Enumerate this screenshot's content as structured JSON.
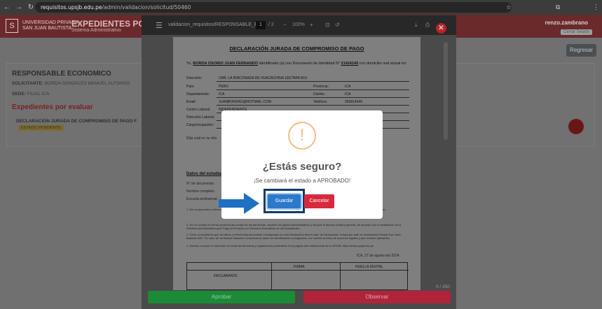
{
  "browser": {
    "url_host": "requisitos.upsjb.edu.pe",
    "url_path": "/admin/validacion/solicitud/50460"
  },
  "app": {
    "logo_line1": "UNIVERSIDAD PRIVADA",
    "logo_line2": "SAN JUAN BAUTISTA",
    "title": "EXPEDIENTES POR EV",
    "subtitle": "Sistema Administrativo",
    "user": "renzo.zambrano",
    "logout": "Cerrar Sesión",
    "back_button": "Regresar"
  },
  "card": {
    "title": "RESPONSABLE ECONOMICO",
    "solicitante_label": "SOLICITANTE:",
    "solicitante_value": "BORDA GONZALES MANUEL ALFONSO",
    "sede_label": "SEDE:",
    "sede_value": "FILIAL ICA",
    "section_title": "Expedientes por evaluar",
    "item_title": "DECLARACIÓN JURADA DE COMPROMISO DE PAGO F",
    "item_badge": "ESTADO: PENDIENTE"
  },
  "viewer": {
    "filename": "validacion_requisitos/RESPONSABLE_E...",
    "page_current": "1",
    "page_total": "/ 2",
    "zoom": "100%",
    "counter": "0 / 250",
    "approve_button": "Aprobar",
    "observe_button": "Observar"
  },
  "pdf": {
    "heading": "DECLARACIÓN JURADA DE COMPROMISO DE PAGO",
    "intro_pre": "Yo, ",
    "intro_name": "BORDA OSORIO JUAN FERNANDO",
    "intro_mid": " identificado (a) con Documento de Identidad N° ",
    "intro_dni": "21424140",
    "intro_post": " con domicilio real actual en:",
    "fields": {
      "direccion_label": "Dirección:",
      "direccion_value": "URB. LA RINCONADA DE HUACACHINA 1EETAPA B19",
      "pais_label": "País:",
      "pais_value": "PERÚ",
      "provincia_label": "Provincia:",
      "provincia_value": "ICA",
      "departamento_label": "Departamento:",
      "departamento_value": "ICA",
      "distrito_label": "Distrito:",
      "distrito_value": "ICA",
      "email_label": "Email:",
      "email_value": "JUANBORDAO@HOTMAIL.COM",
      "telefono_label": "Teléfono:",
      "telefono_value": "955814949",
      "centro_label": "Centro Laboral:",
      "centro_value": "INDEPENDIENTE",
      "direccion_laboral_label": "Dirección Laboral:",
      "cargo_label": "Cargo/ocupación:"
    },
    "elija": "Elija cuál es su rela",
    "section_estudiante": "Datos del estudia",
    "doc_label": "N° de documento:",
    "nombre_label": "Nombre completo:",
    "escuela_label": "Escuela profesional",
    "para1": "1. Me comprometo a efectuar los pagos... generados, desde la fecha... de los Estudiantes vigente... académicos con procedimientos declare conocer y respetar.",
    "para2": "2. De no cumplir en forma oportuna las cuotas de las pensiones, asumiré los gastos administrativos y los que el alumno pudiera generar, de acuerdo con lo establecido en la Directiva Administrativa para Pago de Pensión por Servicios Educativos de los Estudiantes.",
    "para3": "3. Tomo conocimiento que los datos y referencias personales consignadas en esta declaración tienen valor de Declaración Jurada por ante la Universidad Privada San Juan Bautista SAC. En caso de verificarse falsedad o ausencia de datos de identificación consignados, me someto al inicio de acciones legales y que resulten aplicables.",
    "para4": "4. Declaro conocer el contenido de todas las directivas y reglamentos publicados en la página web institucional de la UPSJB: https://www.upsjb.edu.pe",
    "date": "ICA, 27 de agosto del 2024",
    "col_firma": "FIRMA",
    "col_huella": "HUELLA DIGITAL",
    "col_declarante": "DECLARANTE"
  },
  "dialog": {
    "icon": "!",
    "title": "¿Estás seguro?",
    "text": "¡Se cambiará el estado a APROBADO!",
    "confirm": "Guardar",
    "cancel": "Cancelar"
  },
  "colors": {
    "confirm_button": "#2c78c9",
    "cancel_button": "#d9293c",
    "approve_button": "#1c8a37",
    "observe_button": "#b0243a",
    "warning_icon": "#f8bb86",
    "arrow": "#1f6fc2"
  }
}
